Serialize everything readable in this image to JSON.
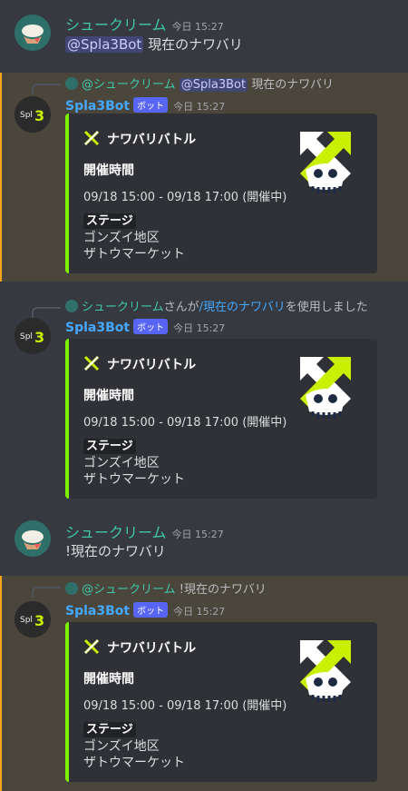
{
  "user_name": "シュークリーム",
  "bot_name": "Spla3Bot",
  "bot_badge": "ボット",
  "messages": [
    {
      "time": "今日 15:27",
      "mention": "@Spla3Bot",
      "text": "現在のナワバリ"
    },
    {
      "reply_name": "@シュークリーム",
      "reply_mention": "@Spla3Bot",
      "reply_text": "現在のナワバリ",
      "time": "今日 15:27",
      "embed": {
        "title": "ナワバリバトル",
        "field1_name": "開催時間",
        "field1_value": "09/18 15:00 - 09/18 17:00 (開催中)",
        "field2_name": "ステージ",
        "stage1": "ゴンズイ地区",
        "stage2": "ザトウマーケット"
      }
    },
    {
      "reply_name": "シュークリーム",
      "reply_pre": "さんが",
      "reply_link": "/現在のナワバリ",
      "reply_post": "を使用しました",
      "time": "今日 15:27",
      "embed": {
        "title": "ナワバリバトル",
        "field1_name": "開催時間",
        "field1_value": "09/18 15:00 - 09/18 17:00 (開催中)",
        "field2_name": "ステージ",
        "stage1": "ゴンズイ地区",
        "stage2": "ザトウマーケット"
      }
    },
    {
      "time": "今日 15:27",
      "text": "!現在のナワバリ"
    },
    {
      "reply_name": "@シュークリーム",
      "reply_text": "!現在のナワバリ",
      "time": "今日 15:27",
      "embed": {
        "title": "ナワバリバトル",
        "field1_name": "開催時間",
        "field1_value": "09/18 15:00 - 09/18 17:00 (開催中)",
        "field2_name": "ステージ",
        "stage1": "ゴンズイ地区",
        "stage2": "ザトウマーケット"
      }
    }
  ],
  "colors": {
    "background": "#36393f",
    "highlight": "#4a463c",
    "highlight_bar": "#faa61a",
    "embed_bg": "#2f3136",
    "embed_accent": "#7cf000",
    "user_name": "#3fc7a9",
    "bot_name": "#44a8ff",
    "badge": "#5865f2"
  },
  "icons": {
    "user_avatar": "user-avatar-icon",
    "bot_avatar": "splatoon3-avatar-icon",
    "embed_title_icon": "turf-war-icon",
    "embed_thumbnail": "turf-war-emblem"
  }
}
